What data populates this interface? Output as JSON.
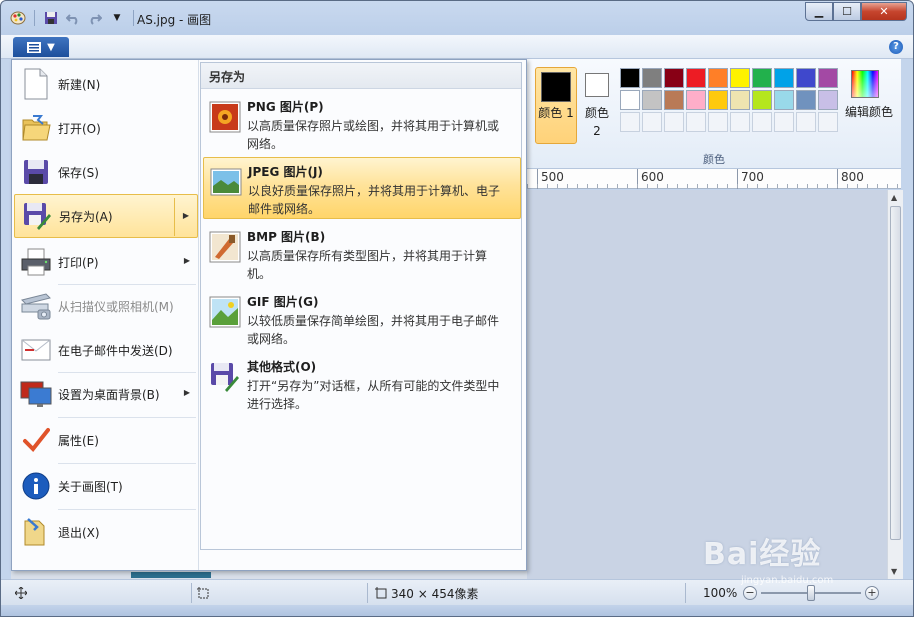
{
  "window": {
    "title": "AS.jpg - 画图",
    "controls": {
      "minimize": "▁",
      "maximize": "☐",
      "close": "✕"
    }
  },
  "quick_access": [
    "paint-app-icon",
    "save-icon",
    "undo-icon",
    "redo-icon",
    "customize-dropdown-icon"
  ],
  "menubar": {
    "help": "?"
  },
  "app_menu": {
    "items": [
      {
        "label": "新建(N)",
        "icon": "new-file-icon"
      },
      {
        "label": "打开(O)",
        "icon": "open-folder-icon"
      },
      {
        "label": "保存(S)",
        "icon": "save-disk-icon"
      },
      {
        "label": "另存为(A)",
        "icon": "save-as-icon",
        "highlighted": true,
        "has_submenu": true
      },
      {
        "label": "打印(P)",
        "icon": "printer-icon",
        "has_submenu": true
      },
      {
        "label": "从扫描仪或照相机(M)",
        "icon": "scanner-icon",
        "disabled": true
      },
      {
        "label": "在电子邮件中发送(D)",
        "icon": "email-icon"
      },
      {
        "label": "设置为桌面背景(B)",
        "icon": "desktop-background-icon",
        "has_submenu": true
      },
      {
        "label": "属性(E)",
        "icon": "checkmark-icon"
      },
      {
        "label": "关于画图(T)",
        "icon": "info-icon"
      },
      {
        "label": "退出(X)",
        "icon": "exit-icon"
      }
    ]
  },
  "save_as_panel": {
    "header": "另存为",
    "items": [
      {
        "title": "PNG 图片(P)",
        "desc": "以高质量保存照片或绘图，并将其用于计算机或网络。",
        "icon": "png-image-icon"
      },
      {
        "title": "JPEG 图片(J)",
        "desc": "以良好质量保存照片，并将其用于计算机、电子邮件或网络。",
        "icon": "jpeg-image-icon",
        "highlighted": true
      },
      {
        "title": "BMP 图片(B)",
        "desc": "以高质量保存所有类型图片，并将其用于计算机。",
        "icon": "bmp-image-icon"
      },
      {
        "title": "GIF 图片(G)",
        "desc": "以较低质量保存简单绘图，并将其用于电子邮件或网络。",
        "icon": "gif-image-icon"
      },
      {
        "title": "其他格式(O)",
        "desc": "打开“另存为”对话框，从所有可能的文件类型中进行选择。",
        "icon": "other-formats-icon"
      }
    ]
  },
  "ribbon": {
    "color1_label": "颜色 1",
    "color2_label": "颜色 2",
    "edit_colors_label": "编辑颜色",
    "group_label": "颜色",
    "color1": "#000000",
    "color2": "#ffffff",
    "palette": [
      "#000000",
      "#7f7f7f",
      "#880015",
      "#ed1c24",
      "#ff7f27",
      "#fff200",
      "#22b14c",
      "#00a2e8",
      "#3f48cc",
      "#a349a4",
      "#ffffff",
      "#c3c3c3",
      "#b97a57",
      "#ffaec9",
      "#ffc90e",
      "#efe4b0",
      "#b5e61d",
      "#99d9ea",
      "#7092be",
      "#c8bfe7"
    ],
    "empty_slots": 10
  },
  "ruler": {
    "marks": [
      "500",
      "600",
      "700",
      "800"
    ]
  },
  "status": {
    "image_size": "340 × 454像素",
    "zoom": "100%",
    "zoom_out": "−",
    "zoom_in": "+"
  },
  "watermark": {
    "logo_text": "Bai经验",
    "url": "jingyan.baidu.com"
  }
}
